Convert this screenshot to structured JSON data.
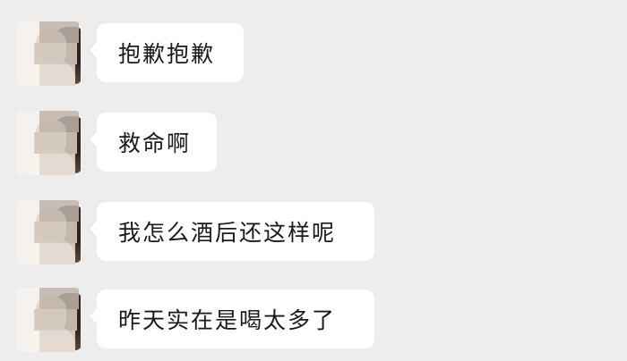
{
  "background_color": "#ededed",
  "bubble_color": "#ffffff",
  "messages": [
    {
      "sender": "other",
      "avatar": "blurred-avatar",
      "text": "抱歉抱歉"
    },
    {
      "sender": "other",
      "avatar": "blurred-avatar",
      "text": "救命啊"
    },
    {
      "sender": "other",
      "avatar": "blurred-avatar",
      "text": "我怎么酒后还这样呢"
    },
    {
      "sender": "other",
      "avatar": "blurred-avatar",
      "text": "昨天实在是喝太多了"
    }
  ]
}
